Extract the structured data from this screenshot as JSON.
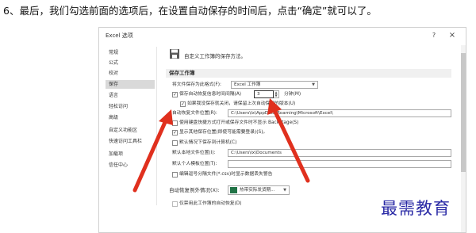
{
  "caption": "6、最后，我们勾选前面的选项后，在设置自动保存的时间后，点击“确定”就可以了。",
  "dialog": {
    "title": "Excel 选项",
    "help_label": "?",
    "close_label": "×"
  },
  "nav": {
    "items": [
      "常规",
      "公式",
      "校对",
      "保存",
      "语言",
      "轻松访问",
      "高级",
      "自定义功能区",
      "快速访问工具栏",
      "加载项",
      "信任中心"
    ],
    "active_index": 3
  },
  "content": {
    "header_text": "自定义工作簿的保存方法。",
    "section_save": "保存工作簿",
    "format_label": "将文件保存为此格式(F):",
    "format_value": "Excel 工作簿",
    "autorecover_label": "保存自动恢复信息时间间隔(A)",
    "autorecover_value": "3",
    "minutes_label": "分钟(M)",
    "keep_last_label": "如果我没保存就关闭，请保留上次自动保留的版本(U)",
    "autorecover_location_label": "自动恢复文件位置(R):",
    "autorecover_location_value": "C:\\Users\\lx\\AppData\\Roaming\\Microsoft\\Excel\\",
    "backstage_label": "使用键盘快捷方式打开或保存文件时不显示 Backstage(S)",
    "show_more_places_label": "显示其他保存位置(即使可能需要登录)(S)。",
    "default_computer_label": "默认情况下保存到计算机(C)",
    "default_local_label": "默认本地文件位置(I):",
    "default_local_value": "C:\\Users\\lx\\Documents",
    "personal_templates_label": "默认个人模板位置(T):",
    "personal_templates_value": "",
    "csv_warning_label": "编辑逗号分隔文件(*.csv)时显示数据丢失警告",
    "section_exceptions": "自动恢复例外情况(X):",
    "exceptions_workbook": "热带实际发货期...",
    "disable_autorecover_label": "仅禁用此工作簿的自动恢复(D)"
  },
  "watermark": "最需教育"
}
